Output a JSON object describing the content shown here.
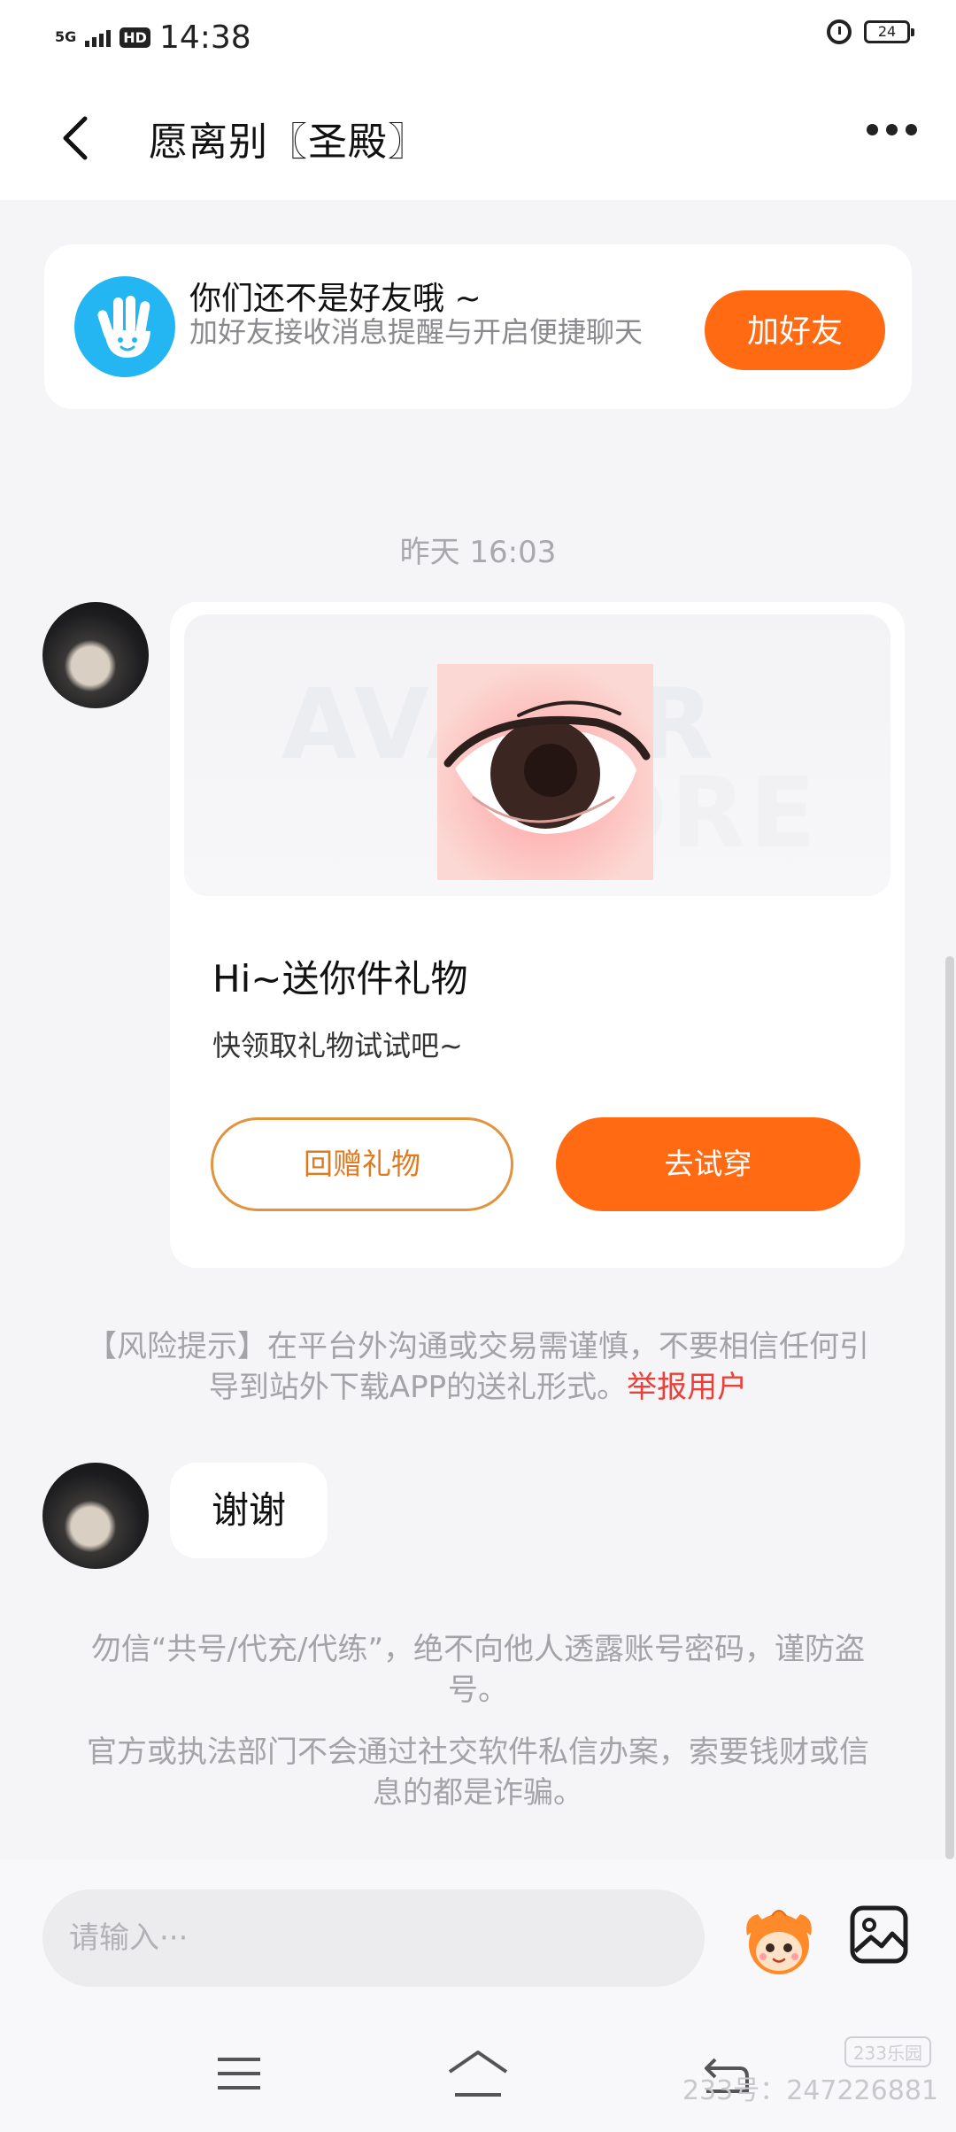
{
  "status_bar": {
    "network": "5G",
    "hd": "HD",
    "time": "14:38",
    "battery": "24"
  },
  "header": {
    "title": "愿离别〖圣殿〗"
  },
  "friend_card": {
    "title": "你们还不是好友哦 ~",
    "subtitle": "加好友接收消息提醒与开启便捷聊天",
    "button": "加好友"
  },
  "chat": {
    "timestamp": "昨天 16:03",
    "gift_card": {
      "watermark_line1": "AVATAR",
      "watermark_line2": "STORE",
      "title": "Hi~送你件礼物",
      "subtitle": "快领取礼物试试吧~",
      "return_gift_button": "回赠礼物",
      "try_on_button": "去试穿"
    },
    "risk_notice": "【风险提示】在平台外沟通或交易需谨慎，不要相信任何引导到站外下载APP的送礼形式。",
    "report_link": "举报用户",
    "message_text": "谢谢",
    "warning_1": "勿信“共号/代充/代练”，绝不向他人透露账号密码，谨防盗号。",
    "warning_2": "官方或执法部门不会通过社交软件私信办案，索要钱财或信息的都是诈骗。"
  },
  "input_bar": {
    "placeholder": "请输入···"
  },
  "watermark": {
    "badge": "233乐园",
    "text": "233号：247226881"
  },
  "colors": {
    "accent": "#ff6a13",
    "outline_button": "#e3923e",
    "report_link": "#e8413b",
    "friend_icon_bg": "#24b6f2"
  }
}
